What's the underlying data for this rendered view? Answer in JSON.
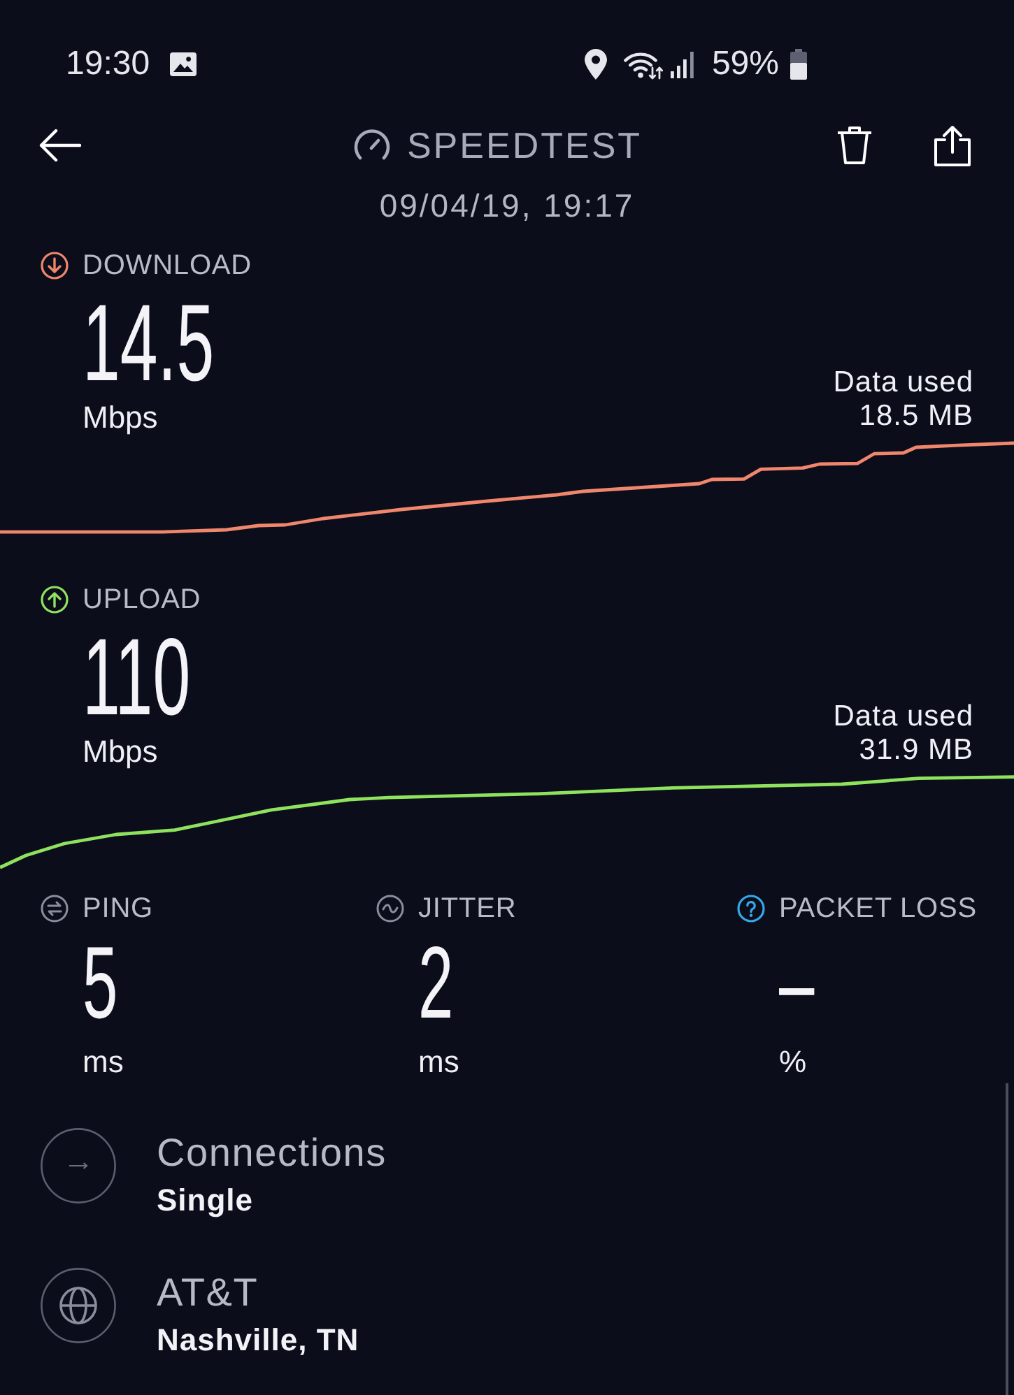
{
  "status_bar": {
    "time": "19:30",
    "battery": "59%"
  },
  "header": {
    "title": "SPEEDTEST",
    "date": "09/04/19, 19:17"
  },
  "tests": [
    {
      "kind": "download",
      "label": "DOWNLOAD",
      "value": "14.5",
      "unit": "Mbps",
      "data_label": "Data used",
      "data_value": "18.5 MB",
      "color": "#f0866c"
    },
    {
      "kind": "upload",
      "label": "UPLOAD",
      "value": "110",
      "unit": "Mbps",
      "data_label": "Data used",
      "data_value": "31.9 MB",
      "color": "#8fe25e"
    }
  ],
  "metrics": [
    {
      "kind": "ping",
      "label": "PING",
      "value": "5",
      "unit": "ms"
    },
    {
      "kind": "jitter",
      "label": "JITTER",
      "value": "2",
      "unit": "ms"
    },
    {
      "kind": "packet_loss",
      "label": "PACKET LOSS",
      "value": "–",
      "unit": "%"
    }
  ],
  "details": [
    {
      "kind": "connections",
      "title": "Connections",
      "value": "Single"
    },
    {
      "kind": "server",
      "title": "AT&T",
      "value": "Nashville, TN"
    }
  ]
}
